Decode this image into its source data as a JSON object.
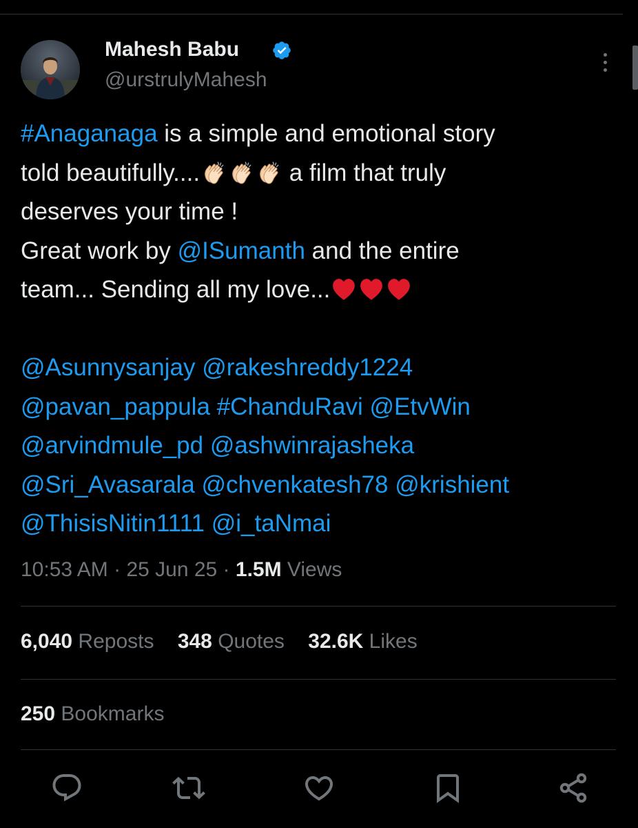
{
  "author": {
    "name": "Mahesh Babu",
    "handle": "@urstrulyMahesh",
    "verified": true,
    "avatar_icon": "avatar-photo"
  },
  "tweet": {
    "lines": [
      [
        {
          "text": "#Anaganaga",
          "link": true
        },
        {
          "text": " is a simple and emotional story"
        }
      ],
      [
        {
          "text": "told beautifully...."
        },
        {
          "emoji": "clap"
        },
        {
          "emoji": "clap"
        },
        {
          "emoji": "clap"
        },
        {
          "text": " a film that truly"
        }
      ],
      [
        {
          "text": "deserves your time !"
        }
      ],
      [
        {
          "text": "Great work by "
        },
        {
          "text": "@ISumanth",
          "link": true
        },
        {
          "text": " and the entire"
        }
      ],
      [
        {
          "text": "team... Sending all my love..."
        },
        {
          "emoji": "heart"
        },
        {
          "emoji": "heart"
        },
        {
          "emoji": "heart"
        }
      ],
      [],
      [
        {
          "text": "@Asunnysanjay",
          "link": true
        },
        {
          "text": " "
        },
        {
          "text": "@rakeshreddy1224",
          "link": true
        }
      ],
      [
        {
          "text": "@pavan_pappula",
          "link": true
        },
        {
          "text": " "
        },
        {
          "text": "#ChanduRavi",
          "link": true
        },
        {
          "text": " "
        },
        {
          "text": "@EtvWin",
          "link": true
        }
      ],
      [
        {
          "text": "@arvindmule_pd",
          "link": true
        },
        {
          "text": " "
        },
        {
          "text": "@ashwinrajasheka",
          "link": true
        }
      ],
      [
        {
          "text": "@Sri_Avasarala",
          "link": true
        },
        {
          "text": " "
        },
        {
          "text": "@chvenkatesh78",
          "link": true
        },
        {
          "text": " "
        },
        {
          "text": "@krishient",
          "link": true
        }
      ],
      [
        {
          "text": "@ThisisNitin1111",
          "link": true
        },
        {
          "text": " "
        },
        {
          "text": "@i_taNmai",
          "link": true
        }
      ]
    ]
  },
  "meta": {
    "time": "10:53 AM",
    "separator": " · ",
    "date": "25 Jun 25",
    "views_count": "1.5M",
    "views_label": " Views"
  },
  "stats": {
    "reposts": {
      "count": "6,040",
      "label": " Reposts"
    },
    "quotes": {
      "count": "348",
      "label": " Quotes"
    },
    "likes": {
      "count": "32.6K",
      "label": " Likes"
    },
    "bookmarks": {
      "count": "250",
      "label": " Bookmarks"
    }
  },
  "actions": [
    "reply-icon",
    "repost-icon",
    "like-icon",
    "bookmark-icon",
    "share-icon"
  ],
  "colors": {
    "background": "#000000",
    "text": "#e7e9ea",
    "secondary": "#71767b",
    "link": "#1d9bf0",
    "divider": "#2f3336",
    "heart": "#e0192b"
  }
}
